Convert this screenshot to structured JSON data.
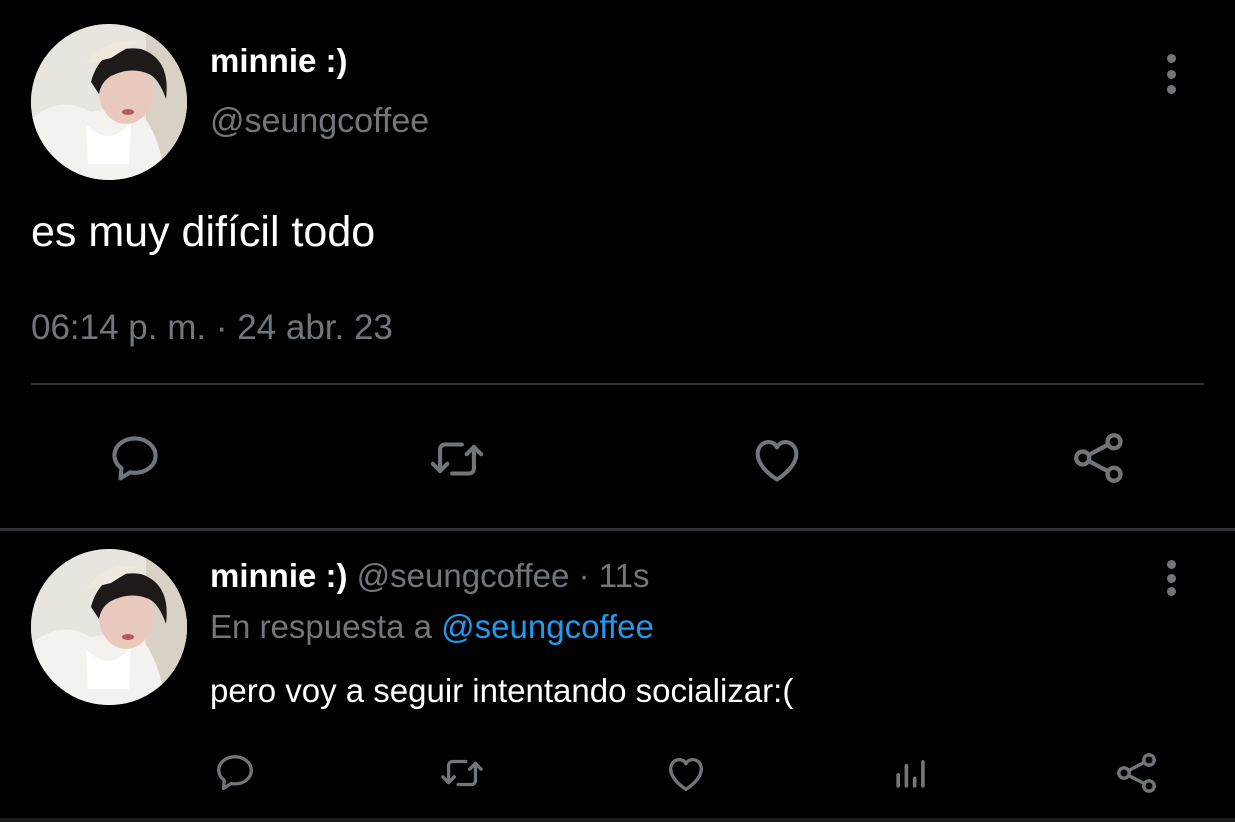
{
  "main_tweet": {
    "display_name": "minnie :)",
    "handle": "@seungcoffee",
    "text": "es muy difícil todo",
    "timestamp": "06:14 p. m. · 24 abr. 23",
    "more_icon": "more-vertical-icon",
    "actions": [
      "reply-icon",
      "retweet-icon",
      "like-icon",
      "share-icon"
    ]
  },
  "reply_tweet": {
    "display_name": "minnie :)",
    "handle": "@seungcoffee",
    "separator": "·",
    "time": "11s",
    "reply_prefix": "En respuesta a",
    "reply_to": "@seungcoffee",
    "text": "pero voy a seguir intentando socializar:(",
    "more_icon": "more-vertical-icon",
    "actions": [
      "reply-icon",
      "retweet-icon",
      "like-icon",
      "analytics-icon",
      "share-icon"
    ]
  },
  "colors": {
    "background": "#000000",
    "primary_text": "#ffffff",
    "secondary_text": "#71767b",
    "link": "#1d9bf0",
    "divider": "#2f3336"
  }
}
